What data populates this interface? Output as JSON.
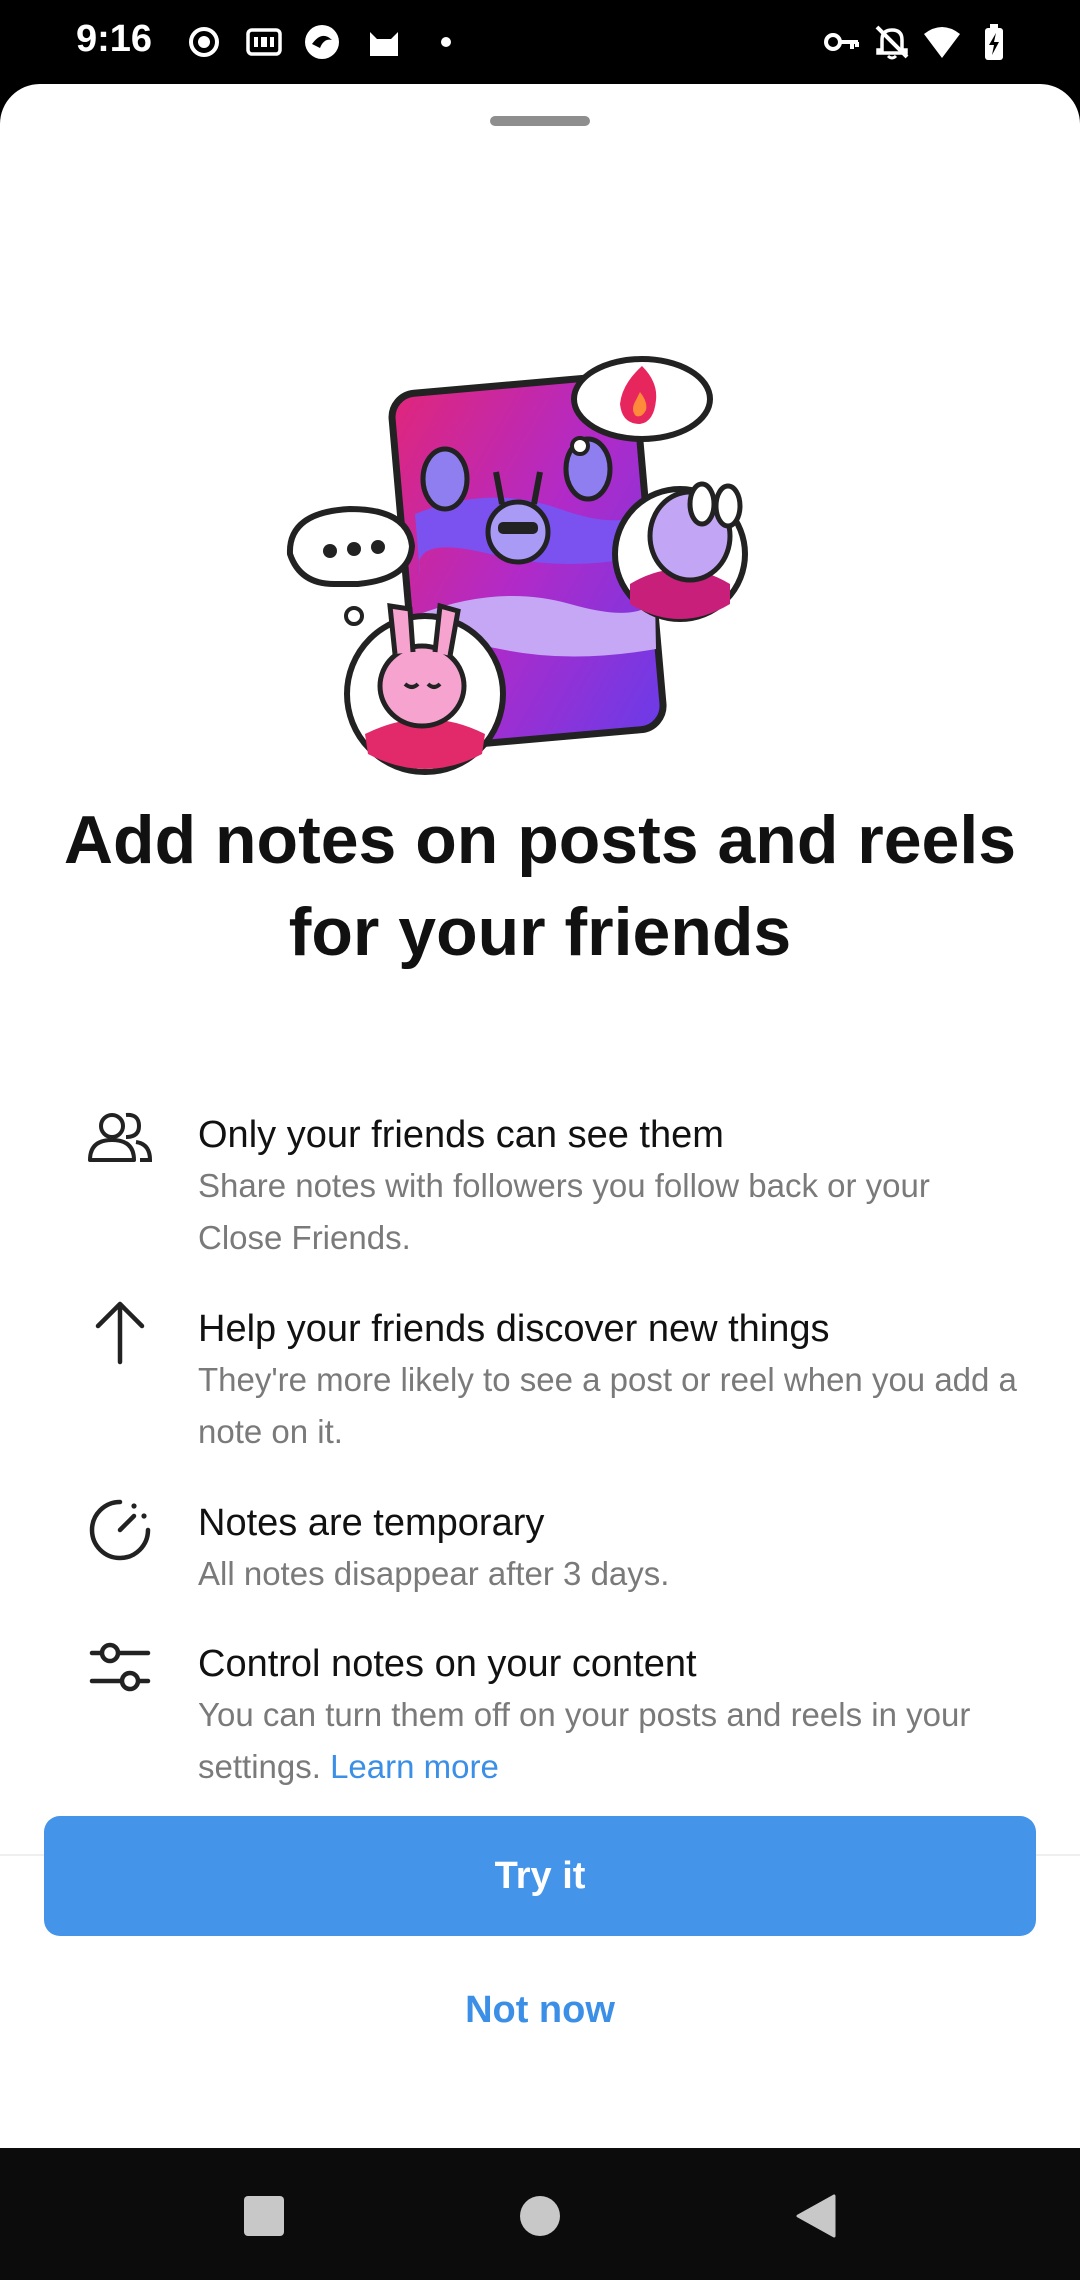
{
  "status_bar": {
    "time": "9:16",
    "left_icons": [
      "record-icon",
      "iqiyi-icon",
      "app-icon",
      "cat-icon",
      "dot-icon"
    ],
    "right_icons": [
      "key-icon",
      "bell-off-icon",
      "wifi-icon",
      "battery-icon"
    ]
  },
  "sheet": {
    "headline": "Add notes on posts and reels for your friends",
    "features": [
      {
        "icon": "friends-icon",
        "title": "Only your friends can see them",
        "body": "Share notes with followers you follow back or your Close Friends."
      },
      {
        "icon": "arrow-up-icon",
        "title": "Help your friends discover new things",
        "body": "They're more likely to see a post or reel when you add a note on it."
      },
      {
        "icon": "timer-icon",
        "title": "Notes are temporary",
        "body": "All notes disappear after 3 days."
      },
      {
        "icon": "sliders-icon",
        "title": "Control notes on your content",
        "body": "You can turn them off on your posts and reels in your settings.",
        "link": "Learn more"
      }
    ],
    "primary_button": "Try it",
    "secondary_button": "Not now"
  },
  "colors": {
    "accent": "#4494ea",
    "link": "#3b8fe6",
    "body_text": "#7a7a7a",
    "title_text": "#111111"
  },
  "nav_bar": {
    "buttons": [
      "recents-square-icon",
      "home-circle-icon",
      "back-triangle-icon"
    ]
  }
}
